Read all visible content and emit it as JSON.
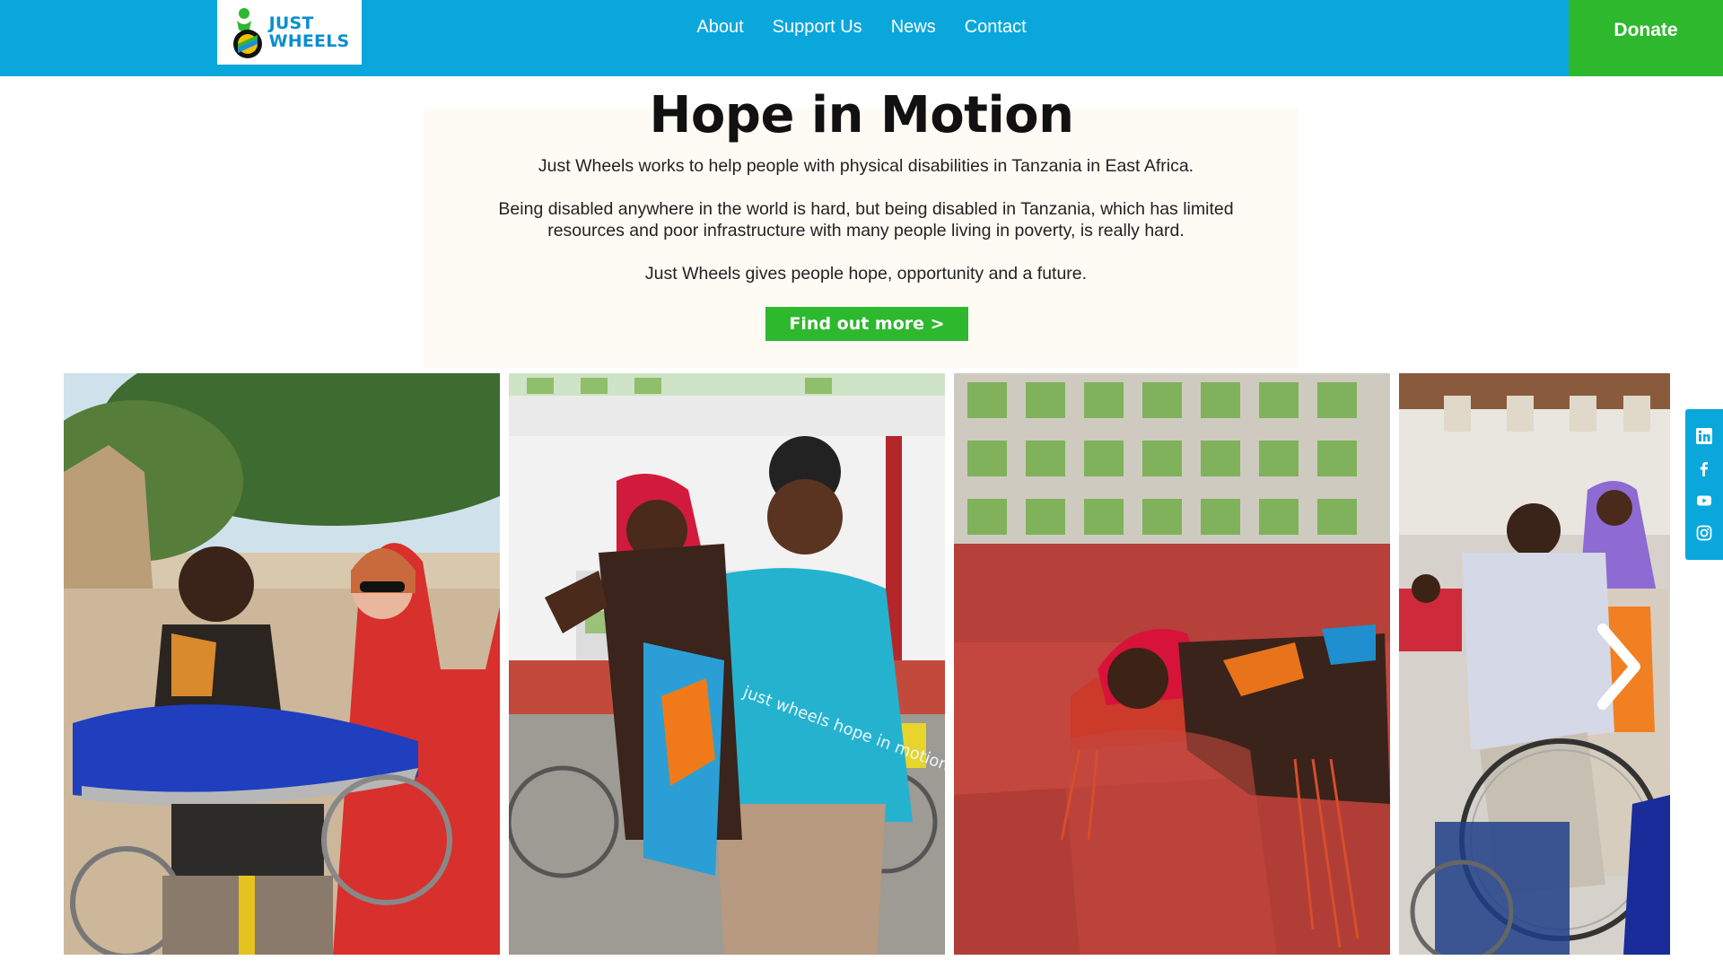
{
  "header": {
    "logo": {
      "line1": "JUST",
      "line2": "WHEELS"
    },
    "nav": [
      "About",
      "Support Us",
      "News",
      "Contact"
    ],
    "donate_label": "Donate"
  },
  "hero": {
    "title": "Hope in Motion",
    "paragraphs": [
      "Just Wheels works to help people with physical disabilities in Tanzania in East Africa.",
      "Being disabled anywhere in the world is hard, but being disabled in Tanzania, which has limited resources and poor infrastructure with many people living in poverty, is really hard.",
      "Just Wheels gives people hope, opportunity and a future."
    ],
    "cta_label": "Find out more >"
  },
  "gallery": {
    "photos": [
      {
        "name": "photo-boy-wheelchair-tray"
      },
      {
        "name": "photo-girl-held-by-woman"
      },
      {
        "name": "photo-girl-lying-red-bench"
      },
      {
        "name": "photo-man-repairing-wheelchair"
      }
    ],
    "tshirt_text": "just wheels hope in motion",
    "next_icon": "chevron-right-icon"
  },
  "social": {
    "icons": [
      "linkedin-icon",
      "facebook-icon",
      "youtube-icon",
      "instagram-icon"
    ]
  },
  "colors": {
    "header_bg": "#0aa7dd",
    "donate_bg": "#2eb82e",
    "panel_bg": "#fdfbf4"
  }
}
